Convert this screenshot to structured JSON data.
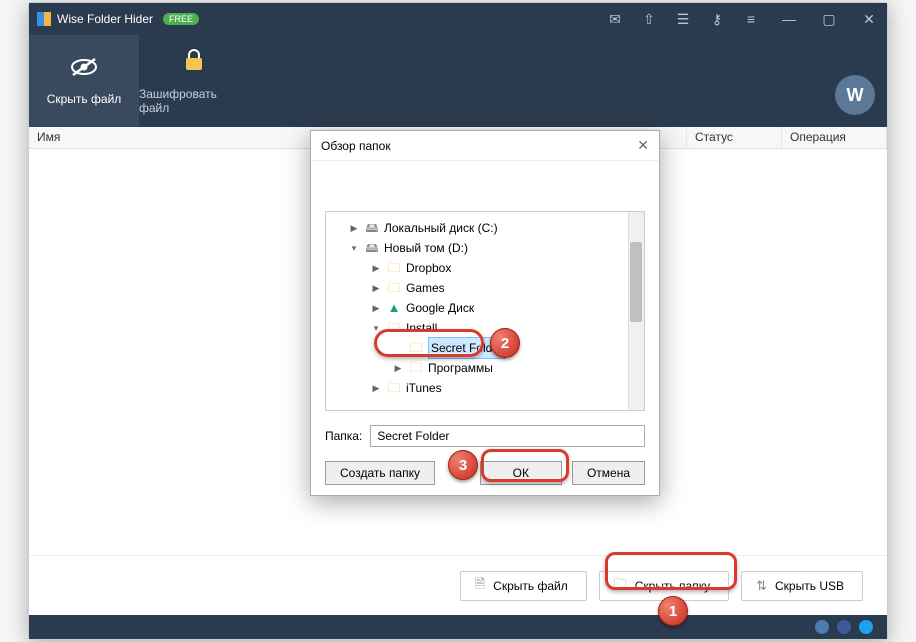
{
  "titlebar": {
    "app_name": "Wise Folder Hider",
    "badge": "FREE"
  },
  "toolbar": {
    "hide_file": "Скрыть файл",
    "encrypt_file": "Зашифровать файл"
  },
  "columns": {
    "name": "Имя",
    "status": "Статус",
    "operation": "Операция"
  },
  "bottom": {
    "hide_file": "Скрыть файл",
    "hide_folder": "Скрыть папку",
    "hide_usb": "Скрыть USB"
  },
  "dialog": {
    "title": "Обзор папок",
    "folder_label": "Папка:",
    "folder_value": "Secret Folder",
    "create_folder": "Создать папку",
    "ok": "ОК",
    "cancel": "Отмена"
  },
  "tree": {
    "drive_c": "Локальный диск (C:)",
    "drive_d": "Новый том (D:)",
    "dropbox": "Dropbox",
    "games": "Games",
    "google_drive": "Google Диск",
    "install": "Install",
    "secret_folder": "Secret Folder",
    "programs": "Программы",
    "itunes": "iTunes"
  },
  "callouts": {
    "n1": "1",
    "n2": "2",
    "n3": "3"
  }
}
